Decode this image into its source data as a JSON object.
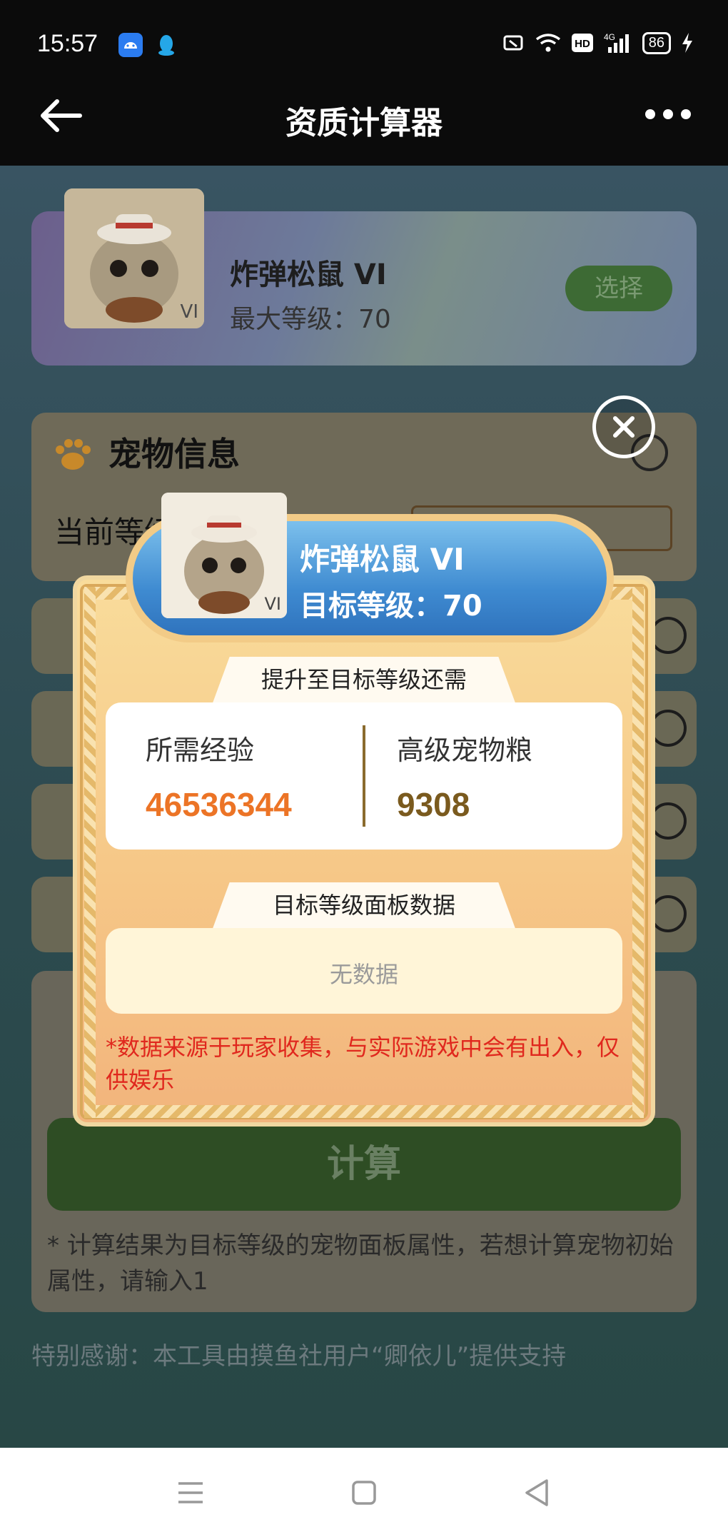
{
  "status_bar": {
    "time": "15:57",
    "icons": [
      "android-icon",
      "qq-icon",
      "nfc-icon",
      "wifi-icon",
      "hd-icon",
      "signal-4g-icon"
    ],
    "battery": "86"
  },
  "header": {
    "title": "资质计算器"
  },
  "pet_banner": {
    "name": "炸弹松鼠 VI",
    "max_level": "最大等级：70",
    "grade_badge": "VI",
    "select_label": "选择"
  },
  "pet_info": {
    "title": "宠物信息",
    "current_level_label": "当前等级"
  },
  "calculate": {
    "button_label": "计算",
    "note": "* 计算结果为目标等级的宠物面板属性，若想计算宠物初始属性，请输入1"
  },
  "credits": "特别感谢：本工具由摸鱼社用户“卿依儿”提供支持",
  "modal": {
    "pet_name": "炸弹松鼠 VI",
    "target_level": "目标等级：70",
    "grade_badge": "VI",
    "requirement_title": "提升至目标等级还需",
    "exp_label": "所需经验",
    "exp_value": "46536344",
    "food_label": "高级宠物粮",
    "food_value": "9308",
    "panel_title": "目标等级面板数据",
    "no_data": "无数据",
    "disclaimer": "*数据来源于玩家收集，与实际游戏中会有出入，仅供娱乐"
  },
  "colors": {
    "exp_value": "#ec7426",
    "food_value": "#7a5a1e",
    "disclaimer": "#e0281e",
    "header_pill": "#3f8bd1"
  }
}
